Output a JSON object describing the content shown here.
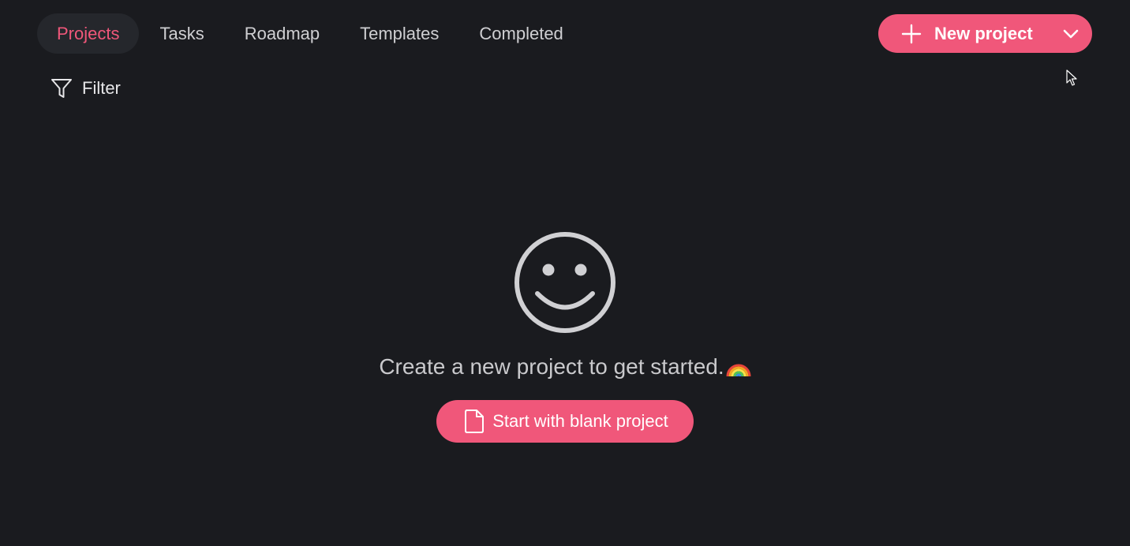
{
  "nav": {
    "tabs": [
      {
        "label": "Projects",
        "active": true
      },
      {
        "label": "Tasks",
        "active": false
      },
      {
        "label": "Roadmap",
        "active": false
      },
      {
        "label": "Templates",
        "active": false
      },
      {
        "label": "Completed",
        "active": false
      }
    ]
  },
  "new_project_button": {
    "label": "New project",
    "icon": "plus-icon",
    "dropdown_icon": "chevron-down-icon"
  },
  "filter": {
    "label": "Filter",
    "icon": "funnel-icon"
  },
  "empty_state": {
    "icon": "smiley-icon",
    "message": "Create a new project to get started.",
    "emoji": "rainbow-icon",
    "blank_button": {
      "label": "Start with blank project",
      "icon": "document-icon"
    }
  },
  "colors": {
    "background": "#1a1b1f",
    "accent": "#f0577a",
    "active_tab_bg": "#25272c",
    "text": "#cfcfd2"
  }
}
